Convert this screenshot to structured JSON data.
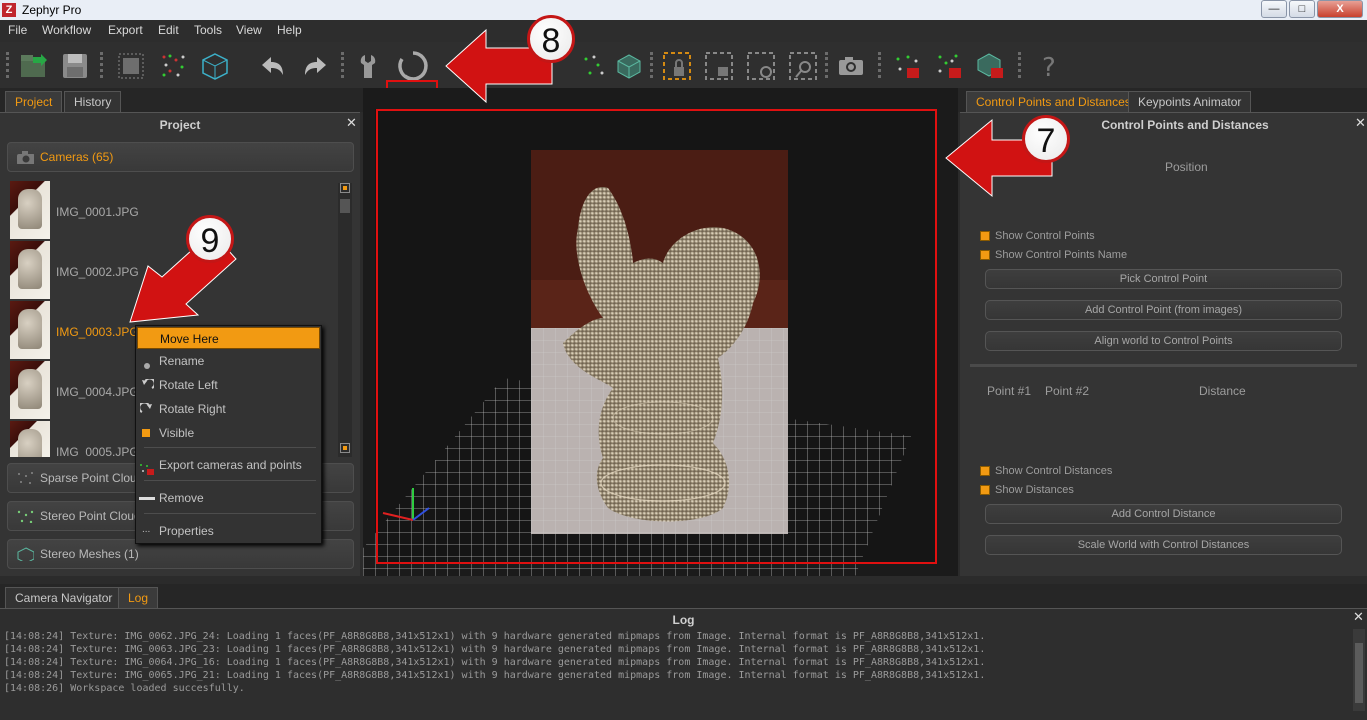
{
  "app": {
    "title": "Zephyr Pro",
    "logo_letter": "Z"
  },
  "window_buttons": {
    "minimize": "—",
    "maximize": "□",
    "close": "X"
  },
  "menu": [
    "File",
    "Workflow",
    "Export",
    "Edit",
    "Tools",
    "View",
    "Help"
  ],
  "toolbar_icons": [
    "new-project-icon",
    "save-icon",
    "sparse-cloud-icon",
    "stereo-points-icon",
    "mesh-cube-icon",
    "undo-icon",
    "redo-icon",
    "wrench-icon",
    "refresh-icon",
    "stereo-points-2-icon",
    "mesh-icon",
    "lock-select-icon",
    "add-select-icon",
    "remove-select-icon",
    "zoom-select-icon",
    "camera-icon",
    "points-red-icon",
    "points-red-2-icon",
    "mesh-red-icon",
    "help-icon"
  ],
  "left_panel": {
    "tabs": [
      "Project",
      "History"
    ],
    "active_tab": "Project",
    "header": "Project",
    "cameras_label": "Cameras (65)",
    "images": [
      "IMG_0001.JPG",
      "IMG_0002.JPG",
      "IMG_0003.JPG",
      "IMG_0004.JPG",
      "IMG_0005.JPG"
    ],
    "selected_image": "IMG_0003.JPG",
    "groups": [
      "Sparse Point Cloud",
      "Stereo Point Clouds",
      "Stereo Meshes (1)"
    ]
  },
  "context_menu": {
    "items": [
      "Move Here",
      "Rename",
      "Rotate Left",
      "Rotate Right",
      "Visible",
      "Export cameras and points",
      "Remove",
      "Properties"
    ],
    "highlighted": "Move Here"
  },
  "right_panel": {
    "tabs": [
      "Control Points and Distances",
      "Keypoints Animator"
    ],
    "active_tab": "Control Points and Distances",
    "header": "Control Points and Distances",
    "position_label": "Position",
    "checkboxes_top": [
      "Show Control Points",
      "Show Control Points Name"
    ],
    "buttons_top": [
      "Pick Control Point",
      "Add Control Point (from images)",
      "Align world to Control Points"
    ],
    "table_headers": [
      "Point #1",
      "Point #2",
      "Distance"
    ],
    "checkboxes_bottom": [
      "Show Control Distances",
      "Show Distances"
    ],
    "buttons_bottom": [
      "Add Control Distance",
      "Scale World with Control Distances"
    ]
  },
  "bottom_panel": {
    "tabs": [
      "Camera Navigator",
      "Log"
    ],
    "active_tab": "Log",
    "header": "Log",
    "lines": [
      "[14:08:24] Texture: IMG_0062.JPG_24: Loading 1 faces(PF_A8R8G8B8,341x512x1) with 9 hardware generated mipmaps from Image. Internal format is PF_A8R8G8B8,341x512x1.",
      "[14:08:24] Texture: IMG_0063.JPG_23: Loading 1 faces(PF_A8R8G8B8,341x512x1) with 9 hardware generated mipmaps from Image. Internal format is PF_A8R8G8B8,341x512x1.",
      "[14:08:24] Texture: IMG_0064.JPG_16: Loading 1 faces(PF_A8R8G8B8,341x512x1) with 9 hardware generated mipmaps from Image. Internal format is PF_A8R8G8B8,341x512x1.",
      "[14:08:24] Texture: IMG_0065.JPG_21: Loading 1 faces(PF_A8R8G8B8,341x512x1) with 9 hardware generated mipmaps from Image. Internal format is PF_A8R8G8B8,341x512x1.",
      "[14:08:26] Workspace loaded succesfully."
    ]
  },
  "annotations": {
    "callouts": [
      "7",
      "8",
      "9"
    ],
    "color": "#c41616"
  },
  "colors": {
    "accent": "#f29a12",
    "highlight_red": "#e01010",
    "background": "#2b2b2b"
  }
}
